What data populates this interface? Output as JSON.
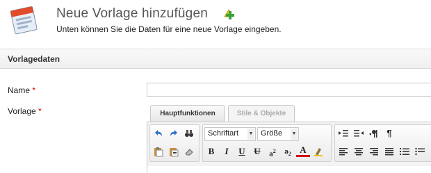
{
  "header": {
    "title": "Neue Vorlage hinzufügen",
    "subtitle": "Unten können Sie die Daten für eine neue Vorlage eingeben."
  },
  "section": {
    "title": "Vorlagedaten"
  },
  "form": {
    "name_label": "Name",
    "template_label": "Vorlage",
    "required_mark": "*",
    "name_value": ""
  },
  "editor": {
    "tabs": [
      "Hauptfunktionen",
      "Stile & Objekte"
    ],
    "font_select": "Schriftart",
    "size_select": "Größe",
    "buttons": {
      "bold": "B",
      "italic": "I",
      "underline": "U",
      "strike": "U",
      "superscript": "a",
      "superscript_exp": "2",
      "subscript": "a",
      "subscript_exp": "2",
      "font_color": "A",
      "pilcrow": "¶"
    }
  },
  "colors": {
    "required": "#cc0000",
    "title": "#555555",
    "accent_green": "#3aa33a",
    "accent_yellow": "#f2c200"
  }
}
